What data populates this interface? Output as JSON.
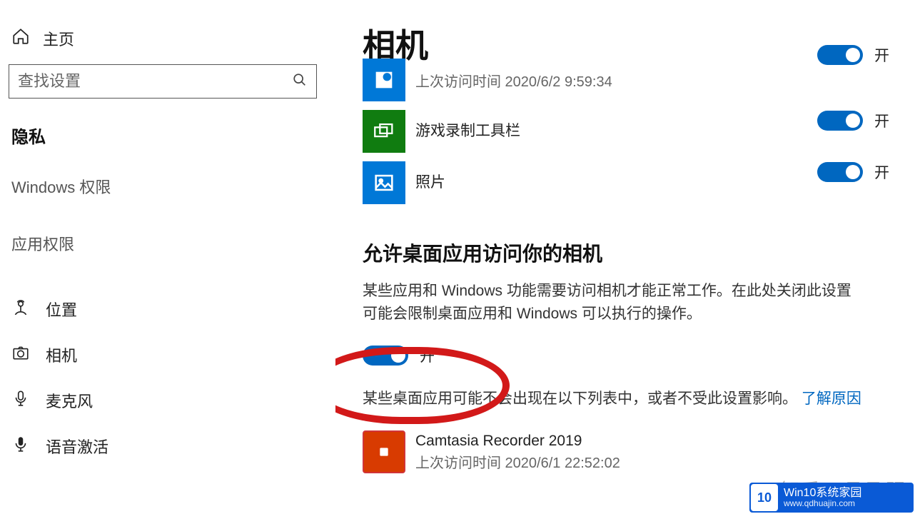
{
  "sidebar": {
    "home": "主页",
    "search_placeholder": "查找设置",
    "privacy": "隐私",
    "windows_perm": "Windows 权限",
    "app_perm": "应用权限",
    "items": {
      "location": "位置",
      "camera": "相机",
      "microphone": "麦克风",
      "voice": "语音激活"
    }
  },
  "main": {
    "title": "相机",
    "apps": {
      "cut_sub": "上次访问时间 2020/6/2 9:59:34",
      "gamebar": "游戏录制工具栏",
      "photos": "照片"
    },
    "on": "开",
    "desktop_heading": "允许桌面应用访问你的相机",
    "desktop_text": "某些应用和 Windows 功能需要访问相机才能正常工作。在此处关闭此设置可能会限制桌面应用和 Windows 可以执行的操作。",
    "desktop_not_listed": "某些桌面应用可能不会出现在以下列表中，或者不受此设置影响。",
    "learn": "了解原因",
    "camtasia": "Camtasia Recorder 2019",
    "camtasia_sub": "上次访问时间 2020/6/1 22:52:02"
  },
  "watermark": "知乎 @飞飞强",
  "badge": {
    "title": "Win10系统家园",
    "sub": "www.qdhuajin.com",
    "icon": "10"
  }
}
